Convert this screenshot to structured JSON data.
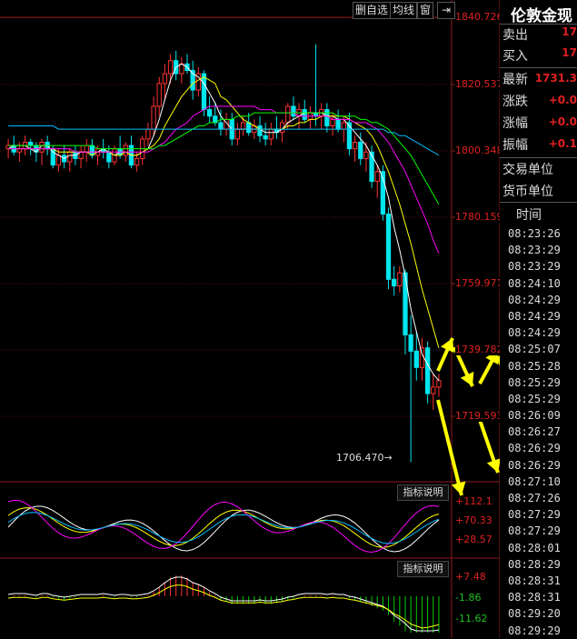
{
  "toolbar": {
    "delete_watch": "删自选",
    "ma_line": "均线",
    "window": "窗",
    "exit_icon": "exit-icon"
  },
  "instrument": {
    "name": "伦敦金现"
  },
  "quote": {
    "sell_label": "卖出",
    "sell_value": "17",
    "buy_label": "买入",
    "buy_value": "17",
    "latest_label": "最新",
    "latest_value": "1731.3",
    "change_label": "涨跌",
    "change_value": "+0.0",
    "pct_label": "涨幅",
    "pct_value": "+0.0",
    "amp_label": "振幅",
    "amp_value": "+0.1",
    "trade_unit_label": "交易单位",
    "currency_label": "货币单位"
  },
  "time_header": "时间",
  "times": [
    "08:23:26",
    "08:23:29",
    "08:23:29",
    "08:24:10",
    "08:24:29",
    "08:24:29",
    "08:24:29",
    "08:25:07",
    "08:25:28",
    "08:25:29",
    "08:25:29",
    "08:26:09",
    "08:26:27",
    "08:26:29",
    "08:26:29",
    "08:27:10",
    "08:27:26",
    "08:27:29",
    "08:27:29",
    "08:28:01",
    "08:28:29",
    "08:28:31",
    "08:28:31",
    "08:29:20",
    "08:29:29"
  ],
  "price_axis": [
    "1840.726",
    "1820.537",
    "1800.348",
    "1780.159",
    "1759.971",
    "1739.782",
    "1719.593"
  ],
  "low_marker": "1706.470",
  "ind1": {
    "button": "指标说明",
    "labels": [
      "+112.1",
      "+70.33",
      "+28.57"
    ]
  },
  "ind2": {
    "button": "指标说明",
    "labels": [
      "+7.48",
      "-1.86",
      "-11.62"
    ]
  },
  "chart_data": {
    "type": "candlestick",
    "ylim": [
      1700,
      1842
    ],
    "colors": {
      "up": "#ff3232",
      "down": "#00e5ee",
      "ma5": "#ffffff",
      "ma10": "#ffff00",
      "ma20": "#ff00ff",
      "ma30": "#00ff00",
      "ma60": "#00bfff"
    },
    "candles": [
      [
        1802,
        1805,
        1799,
        1803
      ],
      [
        1803,
        1806,
        1800,
        1801
      ],
      [
        1801,
        1804,
        1798,
        1802
      ],
      [
        1802,
        1806,
        1800,
        1804
      ],
      [
        1804,
        1805,
        1800,
        1803
      ],
      [
        1803,
        1804,
        1798,
        1801
      ],
      [
        1801,
        1805,
        1797,
        1804
      ],
      [
        1804,
        1806,
        1800,
        1802
      ],
      [
        1802,
        1803,
        1796,
        1797
      ],
      [
        1797,
        1802,
        1795,
        1800
      ],
      [
        1800,
        1803,
        1796,
        1798
      ],
      [
        1798,
        1802,
        1795,
        1801
      ],
      [
        1801,
        1803,
        1797,
        1799
      ],
      [
        1799,
        1803,
        1796,
        1801
      ],
      [
        1801,
        1805,
        1798,
        1803
      ],
      [
        1803,
        1805,
        1799,
        1800
      ],
      [
        1800,
        1803,
        1797,
        1802
      ],
      [
        1802,
        1805,
        1799,
        1801
      ],
      [
        1801,
        1803,
        1796,
        1798
      ],
      [
        1798,
        1803,
        1797,
        1802
      ],
      [
        1802,
        1806,
        1799,
        1800
      ],
      [
        1800,
        1804,
        1798,
        1803
      ],
      [
        1803,
        1806,
        1796,
        1797
      ],
      [
        1797,
        1801,
        1795,
        1799
      ],
      [
        1799,
        1806,
        1797,
        1805
      ],
      [
        1805,
        1810,
        1803,
        1808
      ],
      [
        1808,
        1818,
        1806,
        1815
      ],
      [
        1815,
        1824,
        1812,
        1822
      ],
      [
        1822,
        1828,
        1817,
        1825
      ],
      [
        1825,
        1831,
        1822,
        1829
      ],
      [
        1829,
        1832,
        1823,
        1825
      ],
      [
        1825,
        1830,
        1822,
        1828
      ],
      [
        1828,
        1831,
        1825,
        1826
      ],
      [
        1826,
        1829,
        1817,
        1820
      ],
      [
        1820,
        1827,
        1818,
        1825
      ],
      [
        1825,
        1826,
        1812,
        1814
      ],
      [
        1814,
        1818,
        1810,
        1812
      ],
      [
        1812,
        1816,
        1809,
        1810
      ],
      [
        1810,
        1814,
        1806,
        1808
      ],
      [
        1808,
        1813,
        1806,
        1811
      ],
      [
        1811,
        1813,
        1803,
        1805
      ],
      [
        1805,
        1810,
        1803,
        1808
      ],
      [
        1808,
        1812,
        1806,
        1810
      ],
      [
        1810,
        1813,
        1806,
        1807
      ],
      [
        1807,
        1811,
        1805,
        1809
      ],
      [
        1809,
        1812,
        1804,
        1806
      ],
      [
        1806,
        1810,
        1803,
        1805
      ],
      [
        1805,
        1810,
        1803,
        1808
      ],
      [
        1808,
        1812,
        1805,
        1807
      ],
      [
        1807,
        1811,
        1804,
        1810
      ],
      [
        1810,
        1816,
        1808,
        1815
      ],
      [
        1815,
        1818,
        1811,
        1812
      ],
      [
        1812,
        1816,
        1808,
        1814
      ],
      [
        1814,
        1817,
        1810,
        1811
      ],
      [
        1811,
        1815,
        1808,
        1813
      ],
      [
        1813,
        1834,
        1809,
        1812
      ],
      [
        1812,
        1816,
        1808,
        1814
      ],
      [
        1814,
        1816,
        1807,
        1809
      ],
      [
        1809,
        1813,
        1806,
        1811
      ],
      [
        1811,
        1814,
        1807,
        1808
      ],
      [
        1808,
        1812,
        1804,
        1810
      ],
      [
        1810,
        1813,
        1800,
        1802
      ],
      [
        1802,
        1806,
        1798,
        1804
      ],
      [
        1804,
        1807,
        1797,
        1799
      ],
      [
        1799,
        1804,
        1795,
        1801
      ],
      [
        1801,
        1803,
        1790,
        1792
      ],
      [
        1792,
        1797,
        1787,
        1795
      ],
      [
        1795,
        1797,
        1780,
        1782
      ],
      [
        1782,
        1784,
        1759,
        1762
      ],
      [
        1762,
        1766,
        1757,
        1760
      ],
      [
        1760,
        1766,
        1758,
        1764
      ],
      [
        1764,
        1765,
        1739,
        1745
      ],
      [
        1745,
        1751,
        1706,
        1740
      ],
      [
        1740,
        1746,
        1731,
        1735
      ],
      [
        1735,
        1744,
        1731,
        1741
      ],
      [
        1741,
        1743,
        1724,
        1727
      ],
      [
        1727,
        1733,
        1722,
        1729
      ],
      [
        1729,
        1733,
        1726,
        1731
      ]
    ],
    "ma_series": [
      {
        "name": "MA5",
        "values": [
          1802,
          1803,
          1803,
          1803,
          1802,
          1801,
          1803,
          1803,
          1801,
          1800,
          1799,
          1800,
          1800,
          1801,
          1801,
          1801,
          1801,
          1802,
          1801,
          1800,
          1801,
          1801,
          1800,
          1800,
          1801,
          1802,
          1806,
          1811,
          1817,
          1823,
          1827,
          1828,
          1827,
          1825,
          1824,
          1822,
          1819,
          1816,
          1812,
          1810,
          1808,
          1808,
          1808,
          1808,
          1808,
          1808,
          1807,
          1807,
          1807,
          1808,
          1810,
          1811,
          1812,
          1813,
          1813,
          1813,
          1813,
          1812,
          1812,
          1811,
          1811,
          1809,
          1807,
          1805,
          1803,
          1800,
          1797,
          1793,
          1787,
          1778,
          1771,
          1763,
          1753,
          1746,
          1739,
          1736,
          1733,
          1731
        ]
      },
      {
        "name": "MA10",
        "values": [
          1802,
          1802,
          1802,
          1802,
          1802,
          1802,
          1802,
          1802,
          1802,
          1801,
          1801,
          1801,
          1801,
          1801,
          1801,
          1800,
          1801,
          1801,
          1801,
          1800,
          1800,
          1801,
          1800,
          1800,
          1801,
          1802,
          1803,
          1805,
          1809,
          1812,
          1815,
          1818,
          1820,
          1822,
          1823,
          1824,
          1823,
          1822,
          1818,
          1817,
          1815,
          1813,
          1811,
          1810,
          1809,
          1808,
          1808,
          1808,
          1808,
          1808,
          1809,
          1809,
          1810,
          1810,
          1811,
          1811,
          1812,
          1812,
          1812,
          1812,
          1812,
          1811,
          1810,
          1809,
          1808,
          1806,
          1803,
          1799,
          1795,
          1790,
          1785,
          1779,
          1773,
          1766,
          1759,
          1753,
          1747,
          1741
        ]
      },
      {
        "name": "MA20",
        "values": [
          1802,
          1802,
          1802,
          1802,
          1802,
          1802,
          1802,
          1802,
          1802,
          1802,
          1802,
          1802,
          1801,
          1801,
          1801,
          1801,
          1801,
          1801,
          1801,
          1801,
          1801,
          1801,
          1801,
          1801,
          1801,
          1801,
          1802,
          1803,
          1804,
          1806,
          1808,
          1809,
          1810,
          1812,
          1813,
          1814,
          1815,
          1815,
          1815,
          1815,
          1815,
          1815,
          1815,
          1815,
          1815,
          1814,
          1814,
          1814,
          1813,
          1813,
          1813,
          1813,
          1812,
          1812,
          1812,
          1812,
          1812,
          1812,
          1811,
          1811,
          1811,
          1811,
          1810,
          1810,
          1810,
          1809,
          1808,
          1806,
          1804,
          1801,
          1798,
          1795,
          1791,
          1787,
          1783,
          1779,
          1774,
          1770
        ]
      },
      {
        "name": "MA30",
        "values": [
          1803,
          1803,
          1803,
          1803,
          1803,
          1803,
          1803,
          1803,
          1803,
          1803,
          1803,
          1803,
          1803,
          1803,
          1803,
          1803,
          1802,
          1802,
          1802,
          1802,
          1802,
          1802,
          1802,
          1802,
          1802,
          1802,
          1802,
          1803,
          1803,
          1804,
          1805,
          1806,
          1807,
          1808,
          1809,
          1809,
          1810,
          1810,
          1811,
          1811,
          1811,
          1812,
          1812,
          1812,
          1813,
          1813,
          1813,
          1813,
          1813,
          1813,
          1813,
          1813,
          1813,
          1813,
          1813,
          1813,
          1813,
          1813,
          1813,
          1812,
          1812,
          1812,
          1812,
          1811,
          1811,
          1810,
          1810,
          1809,
          1808,
          1806,
          1804,
          1802,
          1800,
          1797,
          1794,
          1791,
          1788,
          1785
        ]
      },
      {
        "name": "MA60",
        "values": [
          1809,
          1809,
          1809,
          1809,
          1809,
          1809,
          1809,
          1809,
          1809,
          1808,
          1808,
          1808,
          1808,
          1808,
          1808,
          1808,
          1808,
          1808,
          1808,
          1808,
          1808,
          1808,
          1808,
          1808,
          1808,
          1808,
          1808,
          1808,
          1808,
          1808,
          1808,
          1808,
          1808,
          1808,
          1808,
          1808,
          1808,
          1808,
          1808,
          1808,
          1808,
          1808,
          1808,
          1808,
          1808,
          1808,
          1808,
          1808,
          1808,
          1808,
          1808,
          1808,
          1808,
          1808,
          1808,
          1808,
          1808,
          1808,
          1808,
          1808,
          1808,
          1808,
          1808,
          1808,
          1808,
          1808,
          1808,
          1808,
          1807,
          1807,
          1806,
          1806,
          1805,
          1804,
          1803,
          1802,
          1801,
          1800
        ]
      }
    ]
  }
}
